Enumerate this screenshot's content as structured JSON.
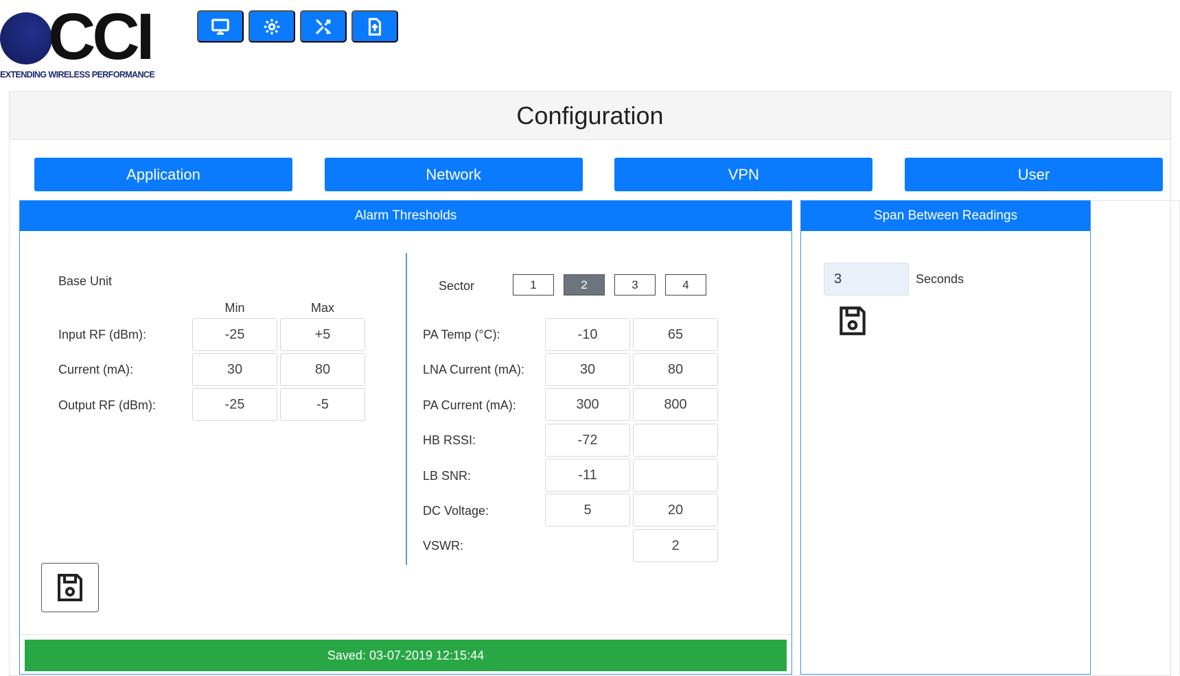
{
  "logo": {
    "text": "CCI",
    "tagline": "EXTENDING WIRELESS PERFORMANCE"
  },
  "toolbar": {
    "items": [
      {
        "icon": "monitor-icon"
      },
      {
        "icon": "gear-icon"
      },
      {
        "icon": "tools-icon"
      },
      {
        "icon": "file-upload-icon"
      }
    ]
  },
  "page": {
    "title": "Configuration"
  },
  "tabs": [
    "Application",
    "Network",
    "VPN",
    "User"
  ],
  "alarm": {
    "title": "Alarm Thresholds",
    "base_unit": {
      "label": "Base Unit",
      "col_min": "Min",
      "col_max": "Max",
      "rows": [
        {
          "label": "Input RF (dBm):",
          "min": "-25",
          "max": "+5"
        },
        {
          "label": "Current (mA):",
          "min": "30",
          "max": "80"
        },
        {
          "label": "Output RF (dBm):",
          "min": "-25",
          "max": "-5"
        }
      ]
    },
    "sector": {
      "label": "Sector",
      "options": [
        "1",
        "2",
        "3",
        "4"
      ],
      "selected": "2",
      "rows": [
        {
          "label": "PA Temp (°C):",
          "min": "-10",
          "max": "65"
        },
        {
          "label": "LNA Current (mA):",
          "min": "30",
          "max": "80"
        },
        {
          "label": "PA Current (mA):",
          "min": "300",
          "max": "800"
        },
        {
          "label": "HB RSSI:",
          "min": "-72",
          "max": ""
        },
        {
          "label": "LB SNR:",
          "min": "-11",
          "max": ""
        },
        {
          "label": "DC Voltage:",
          "min": "5",
          "max": "20"
        },
        {
          "label": "VSWR:",
          "min": null,
          "max": "2"
        }
      ]
    },
    "saved_status": "Saved: 03-07-2019 12:15:44"
  },
  "span": {
    "title": "Span Between Readings",
    "value": "3",
    "unit": "Seconds"
  },
  "colors": {
    "accent": "#0a7bff",
    "success": "#28a745",
    "sector_active": "#6c757d"
  }
}
